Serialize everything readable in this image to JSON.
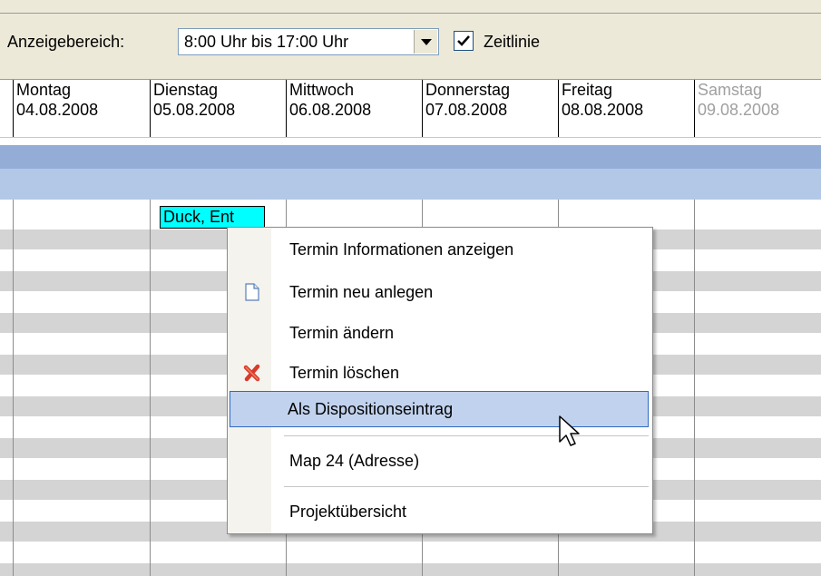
{
  "toolbar": {
    "range_label": "Anzeigebereich:",
    "range_value": "8:00 Uhr bis 17:00 Uhr",
    "timeline_checked": true,
    "timeline_label": "Zeitlinie"
  },
  "days": [
    {
      "name": "Montag",
      "date": "04.08.2008"
    },
    {
      "name": "Dienstag",
      "date": "05.08.2008"
    },
    {
      "name": "Mittwoch",
      "date": "06.08.2008"
    },
    {
      "name": "Donnerstag",
      "date": "07.08.2008"
    },
    {
      "name": "Freitag",
      "date": "08.08.2008"
    },
    {
      "name": "Samstag",
      "date": "09.08.2008"
    }
  ],
  "appointment": {
    "label": "Duck, Ent"
  },
  "context_menu": {
    "items": [
      {
        "label": "Termin Informationen anzeigen",
        "icon": null
      },
      {
        "label": "Termin neu anlegen",
        "icon": "new-document-icon"
      },
      {
        "label": "Termin ändern",
        "icon": null
      },
      {
        "label": "Termin löschen",
        "icon": "delete-x-icon"
      },
      {
        "label": "Als Dispositionseintrag",
        "icon": null,
        "highlighted": true
      },
      {
        "label": "Map 24 (Adresse)",
        "icon": null
      },
      {
        "label": "Projektübersicht",
        "icon": null
      }
    ]
  },
  "colors": {
    "appointment_bg": "#00ffff",
    "band_dark": "#93add7",
    "band_light": "#b3c8e6",
    "highlight": "#c1d2ee",
    "highlight_border": "#316ac5"
  }
}
